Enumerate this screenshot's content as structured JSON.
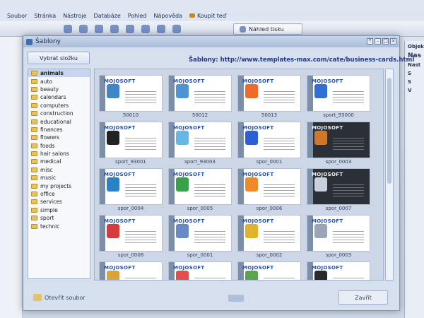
{
  "menubar": {
    "items": [
      "Soubor",
      "Stránka",
      "Nástroje",
      "Databáze",
      "Pohled",
      "Nápověda"
    ],
    "buy_label": "Koupit teď"
  },
  "toolbar": {
    "preview_label": "Náhled tisku"
  },
  "right_panel": {
    "labels": [
      "Objek",
      "Nas",
      "Nast",
      "S",
      "S",
      "V"
    ]
  },
  "dialog": {
    "title": "Šablony",
    "select_folder_label": "Vybrat složku",
    "header_link": "Šablony: http://www.templates-max.com/cate/business-cards.html",
    "folders": [
      "animals",
      "auto",
      "beauty",
      "calendars",
      "computers",
      "construction",
      "educational",
      "finances",
      "flowers",
      "foods",
      "hair salons",
      "medical",
      "misc",
      "music",
      "my projects",
      "office",
      "services",
      "simple",
      "sport",
      "technic"
    ],
    "selected_folder": "animals",
    "brand": "MOJOSOFT",
    "templates": [
      {
        "label": "50010",
        "style": "light",
        "pic": "#3f86c7"
      },
      {
        "label": "50012",
        "style": "light",
        "pic": "#4e93d3"
      },
      {
        "label": "50013",
        "style": "light",
        "pic": "#f06a2a"
      },
      {
        "label": "sport_93000",
        "style": "light",
        "pic": "#2f6fd6"
      },
      {
        "label": "sport_93001",
        "style": "light",
        "pic": "#222222"
      },
      {
        "label": "sport_93003",
        "style": "light",
        "pic": "#67b7e6"
      },
      {
        "label": "spor_0001",
        "style": "light",
        "pic": "#2c5ed4"
      },
      {
        "label": "spor_0003",
        "style": "dark",
        "pic": "#d0772c"
      },
      {
        "label": "spor_0004",
        "style": "light",
        "pic": "#2a82c4"
      },
      {
        "label": "spor_0005",
        "style": "light",
        "pic": "#37a24a"
      },
      {
        "label": "spor_0006",
        "style": "light",
        "pic": "#f08a27"
      },
      {
        "label": "spor_0007",
        "style": "dark",
        "pic": "#c9d1df"
      },
      {
        "label": "spor_0008",
        "style": "light",
        "pic": "#d83b3b"
      },
      {
        "label": "spor_0001",
        "style": "light",
        "pic": "#6a88c6"
      },
      {
        "label": "spor_0002",
        "style": "light",
        "pic": "#e3b22b"
      },
      {
        "label": "spor_0003",
        "style": "light",
        "pic": "#9aa5b7"
      },
      {
        "label": "",
        "style": "light",
        "pic": "#d8a23d"
      },
      {
        "label": "",
        "style": "light",
        "pic": "#e24e4e"
      },
      {
        "label": "",
        "style": "light",
        "pic": "#5aa34f"
      },
      {
        "label": "",
        "style": "light",
        "pic": "#2a2a2a"
      }
    ],
    "open_file_label": "Otevřít soubor",
    "close_label": "Zavřít"
  },
  "colors": {
    "accent": "#2b4fa3",
    "dialog_bg": "#d6dfed",
    "selection": "#c7d6ef"
  }
}
